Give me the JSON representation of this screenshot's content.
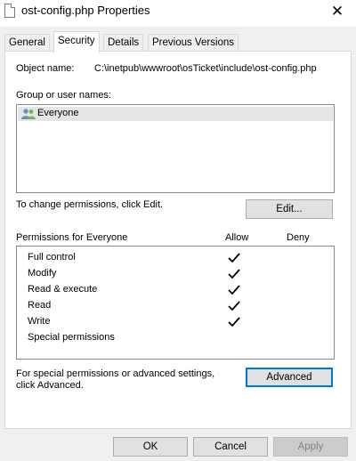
{
  "window": {
    "title": "ost-config.php Properties",
    "close_label": "✕"
  },
  "tabs": [
    {
      "label": "General"
    },
    {
      "label": "Security"
    },
    {
      "label": "Details"
    },
    {
      "label": "Previous Versions"
    }
  ],
  "security": {
    "object_name_label": "Object name:",
    "object_name_value": "C:\\inetpub\\wwwroot\\osTicket\\include\\ost-config.php",
    "group_label": "Group or user names:",
    "groups": [
      {
        "name": "Everyone",
        "icon": "users-icon"
      }
    ],
    "change_text": "To change permissions, click Edit.",
    "edit_button": "Edit...",
    "permissions_for": "Permissions for Everyone",
    "allow_header": "Allow",
    "deny_header": "Deny",
    "permissions": [
      {
        "name": "Full control",
        "allow": true,
        "deny": false
      },
      {
        "name": "Modify",
        "allow": true,
        "deny": false
      },
      {
        "name": "Read & execute",
        "allow": true,
        "deny": false
      },
      {
        "name": "Read",
        "allow": true,
        "deny": false
      },
      {
        "name": "Write",
        "allow": true,
        "deny": false
      },
      {
        "name": "Special permissions",
        "allow": false,
        "deny": false
      }
    ],
    "advanced_text_line1": "For special permissions or advanced settings,",
    "advanced_text_line2": "click Advanced.",
    "advanced_button": "Advanced"
  },
  "footer": {
    "ok": "OK",
    "cancel": "Cancel",
    "apply": "Apply"
  }
}
